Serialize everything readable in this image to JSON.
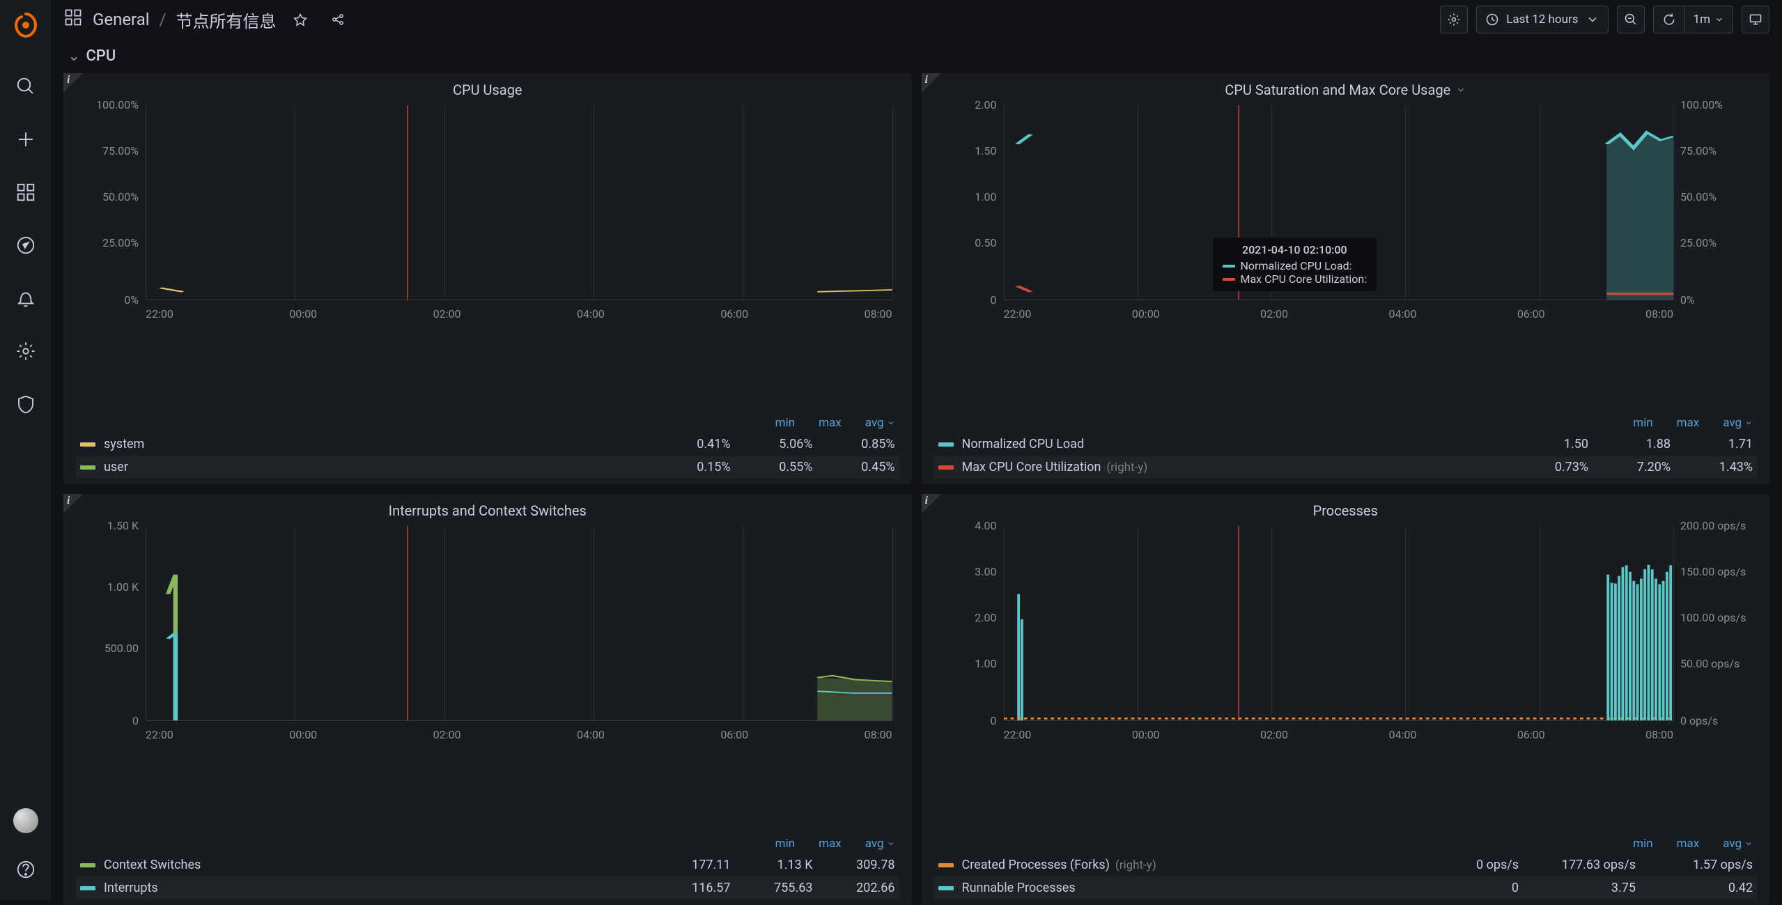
{
  "breadcrumb": {
    "folder": "General",
    "sep": "/",
    "dashboard": "节点所有信息"
  },
  "time_range": "Last 12 hours",
  "refresh_interval": "1m",
  "section": {
    "title": "CPU"
  },
  "tooltip": {
    "timestamp": "2021-04-10 02:10:00",
    "rows": [
      {
        "label": "Normalized CPU Load:",
        "color": "#5ac8c8"
      },
      {
        "label": "Max CPU Core Utilization:",
        "color": "#d44a3a"
      }
    ]
  },
  "legend_cols": {
    "min": "min",
    "max": "max",
    "avg": "avg"
  },
  "panels": [
    {
      "id": "cpu-usage",
      "title": "CPU Usage",
      "y_left": [
        "100.00%",
        "75.00%",
        "50.00%",
        "25.00%",
        "0%"
      ],
      "x_ticks": [
        "22:00",
        "00:00",
        "02:00",
        "04:00",
        "06:00",
        "08:00"
      ],
      "legend": [
        {
          "name": "system",
          "color": "#e0c060",
          "min": "0.41%",
          "max": "5.06%",
          "avg": "0.85%"
        },
        {
          "name": "user",
          "color": "#8ab85c",
          "min": "0.15%",
          "max": "0.55%",
          "avg": "0.45%"
        }
      ]
    },
    {
      "id": "cpu-saturation",
      "title": "CPU Saturation and Max Core Usage",
      "has_dropdown": true,
      "y_left": [
        "2.00",
        "1.50",
        "1.00",
        "0.50",
        "0"
      ],
      "y_right": [
        "100.00%",
        "75.00%",
        "50.00%",
        "25.00%",
        "0%"
      ],
      "x_ticks": [
        "22:00",
        "00:00",
        "02:00",
        "04:00",
        "06:00",
        "08:00"
      ],
      "legend": [
        {
          "name": "Normalized CPU Load",
          "color": "#5ac8c8",
          "min": "1.50",
          "max": "1.88",
          "avg": "1.71"
        },
        {
          "name": "Max CPU Core Utilization",
          "sublabel": "(right-y)",
          "color": "#d44a3a",
          "min": "0.73%",
          "max": "7.20%",
          "avg": "1.43%"
        }
      ]
    },
    {
      "id": "interrupts",
      "title": "Interrupts and Context Switches",
      "y_left": [
        "1.50 K",
        "1.00 K",
        "500.00",
        "0"
      ],
      "x_ticks": [
        "22:00",
        "00:00",
        "02:00",
        "04:00",
        "06:00",
        "08:00"
      ],
      "legend": [
        {
          "name": "Context Switches",
          "color": "#8ab85c",
          "min": "177.11",
          "max": "1.13 K",
          "avg": "309.78"
        },
        {
          "name": "Interrupts",
          "color": "#5ac8c8",
          "min": "116.57",
          "max": "755.63",
          "avg": "202.66"
        }
      ]
    },
    {
      "id": "processes",
      "title": "Processes",
      "y_left": [
        "4.00",
        "3.00",
        "2.00",
        "1.00",
        "0"
      ],
      "y_right": [
        "200.00 ops/s",
        "150.00 ops/s",
        "100.00 ops/s",
        "50.00 ops/s",
        "0 ops/s"
      ],
      "x_ticks": [
        "22:00",
        "00:00",
        "02:00",
        "04:00",
        "06:00",
        "08:00"
      ],
      "legend": [
        {
          "name": "Created Processes (Forks)",
          "sublabel": "(right-y)",
          "color": "#e08a3a",
          "min": "0 ops/s",
          "max": "177.63 ops/s",
          "avg": "1.57 ops/s"
        },
        {
          "name": "Runnable Processes",
          "color": "#5ac8c8",
          "min": "0",
          "max": "3.75",
          "avg": "0.42"
        }
      ]
    }
  ],
  "chart_data": [
    {
      "panel": "cpu-usage",
      "type": "line",
      "xlabel": "",
      "ylabel": "%",
      "ylim": [
        0,
        100
      ],
      "x": [
        "22:00",
        "00:00",
        "02:00",
        "04:00",
        "06:00",
        "08:00"
      ],
      "series": [
        {
          "name": "system",
          "values": [
            3.0,
            0,
            0,
            0,
            0,
            2.5
          ]
        },
        {
          "name": "user",
          "values": [
            0.4,
            0,
            0,
            0,
            0,
            0.4
          ]
        }
      ]
    },
    {
      "panel": "cpu-saturation",
      "type": "line",
      "ylim_left": [
        0,
        2
      ],
      "ylim_right": [
        0,
        100
      ],
      "x": [
        "22:00",
        "00:00",
        "02:00",
        "04:00",
        "06:00",
        "08:00"
      ],
      "series": [
        {
          "name": "Normalized CPU Load",
          "axis": "left",
          "values": [
            1.7,
            null,
            null,
            null,
            null,
            1.75
          ]
        },
        {
          "name": "Max CPU Core Utilization",
          "axis": "right",
          "values": [
            5.0,
            null,
            null,
            null,
            null,
            1.5
          ]
        }
      ]
    },
    {
      "panel": "interrupts",
      "type": "line",
      "ylim": [
        0,
        1500
      ],
      "x": [
        "22:00",
        "00:00",
        "02:00",
        "04:00",
        "06:00",
        "08:00"
      ],
      "series": [
        {
          "name": "Context Switches",
          "values": [
            900,
            0,
            0,
            0,
            0,
            320
          ]
        },
        {
          "name": "Interrupts",
          "values": [
            550,
            0,
            0,
            0,
            0,
            210
          ]
        }
      ]
    },
    {
      "panel": "processes",
      "type": "bar",
      "ylim_left": [
        0,
        4
      ],
      "ylim_right": [
        0,
        200
      ],
      "x": [
        "22:00",
        "00:00",
        "02:00",
        "04:00",
        "06:00",
        "08:00"
      ],
      "series": [
        {
          "name": "Created Processes (Forks)",
          "axis": "right",
          "values": [
            20,
            1,
            1,
            1,
            1,
            5
          ]
        },
        {
          "name": "Runnable Processes",
          "axis": "left",
          "values": [
            2.5,
            0.02,
            0.02,
            0.02,
            0.02,
            2.8
          ]
        }
      ]
    }
  ]
}
